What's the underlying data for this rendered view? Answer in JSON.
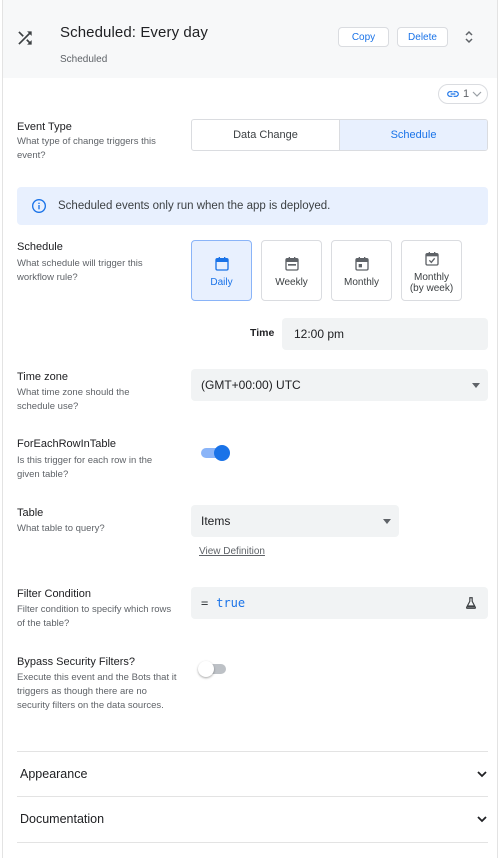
{
  "header": {
    "title": "Scheduled: Every day",
    "subtitle": "Scheduled",
    "copy_label": "Copy",
    "delete_label": "Delete",
    "link_count": "1"
  },
  "event_type": {
    "label": "Event Type",
    "help": "What type of change triggers this event?",
    "options": [
      "Data Change",
      "Schedule"
    ],
    "selected": "Schedule"
  },
  "info_banner": {
    "text": "Scheduled events only run when the app is deployed."
  },
  "schedule": {
    "label": "Schedule",
    "help": "What schedule will trigger this workflow rule?",
    "options": [
      {
        "label": "Daily",
        "icon": "calendar-day-icon"
      },
      {
        "label": "Weekly",
        "icon": "calendar-week-icon"
      },
      {
        "label": "Monthly",
        "icon": "calendar-month-icon"
      },
      {
        "label": "Monthly\n(by week)",
        "icon": "calendar-check-icon"
      }
    ],
    "selected": "Daily"
  },
  "time": {
    "label": "Time",
    "value": "12:00 pm"
  },
  "time_zone": {
    "label": "Time zone",
    "help": "What time zone should the schedule use?",
    "value": "(GMT+00:00) UTC"
  },
  "for_each_row": {
    "label": "ForEachRowInTable",
    "help": "Is this trigger for each row in the given table?",
    "enabled": true
  },
  "table": {
    "label": "Table",
    "help": "What table to query?",
    "value": "Items",
    "view_definition": "View Definition"
  },
  "filter_condition": {
    "label": "Filter Condition",
    "help": "Filter condition to specify which rows of the table?",
    "prefix": "=",
    "value": "true"
  },
  "bypass_security": {
    "label": "Bypass Security Filters?",
    "help": "Execute this event and the Bots that it triggers as though there are no security filters on the data sources.",
    "enabled": false
  },
  "sections": {
    "appearance": "Appearance",
    "documentation": "Documentation"
  },
  "colors": {
    "accent": "#1a73e8",
    "accent_light": "#e8f0fe",
    "field_bg": "#f1f3f4",
    "header_bg": "#f7f8f9"
  }
}
